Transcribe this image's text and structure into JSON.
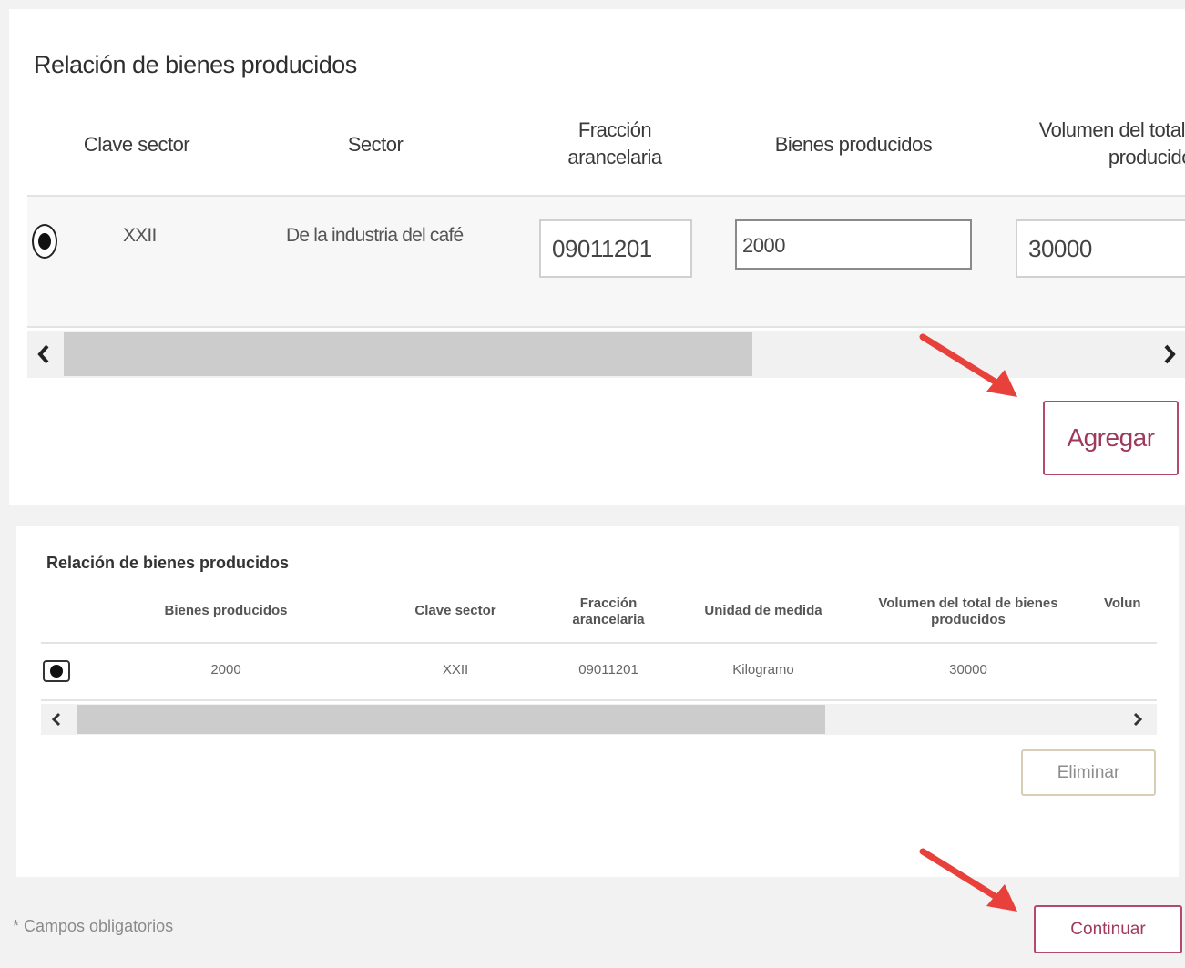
{
  "top_section": {
    "title": "Relación de bienes producidos",
    "headers": {
      "clave_sector": "Clave sector",
      "sector": "Sector",
      "fraccion_line1": "Fracción",
      "fraccion_line2": "arancelaria",
      "bienes": "Bienes producidos",
      "volumen_line1": "Volumen del total",
      "volumen_line2": "producido"
    },
    "row": {
      "clave_sector": "XXII",
      "sector": "De la industria del café",
      "fraccion_value": "09011201",
      "bienes_value": "2000",
      "volumen_value": "30000",
      "selected": true
    },
    "add_button": "Agregar",
    "scroll_left_icon": "chevron-left-icon",
    "scroll_right_icon": "chevron-right-icon"
  },
  "bottom_section": {
    "title": "Relación de bienes producidos",
    "headers": {
      "bienes": "Bienes producidos",
      "clave_sector": "Clave sector",
      "fraccion_line1": "Fracción",
      "fraccion_line2": "arancelaria",
      "unidad": "Unidad de medida",
      "volumen_line1": "Volumen del total de bienes",
      "volumen_line2": "producidos",
      "volumen_cut": "Volun"
    },
    "rows": [
      {
        "bienes": "2000",
        "clave_sector": "XXII",
        "fraccion": "09011201",
        "unidad": "Kilogramo",
        "volumen": "30000",
        "selected": true
      }
    ],
    "delete_button": "Eliminar"
  },
  "footer": {
    "required_note": "* Campos obligatorios",
    "continue_button": "Continuar"
  },
  "colors": {
    "accent": "#9e3a5a",
    "arrow": "#e8403a",
    "delete_border": "#d9cdb5"
  }
}
